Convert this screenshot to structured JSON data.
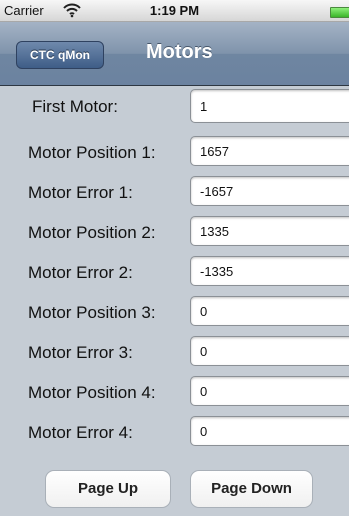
{
  "status_bar": {
    "carrier": "Carrier",
    "time": "1:19 PM",
    "wifi_icon": "wifi-icon",
    "battery_icon": "battery-icon",
    "battery_color": "#3bb52a"
  },
  "nav": {
    "back_label": "CTC qMon",
    "title": "Motors"
  },
  "form": {
    "first_motor": {
      "label": "First Motor:",
      "value": "1"
    },
    "rows": [
      {
        "label": "Motor Position 1:",
        "value": "1657"
      },
      {
        "label": "Motor Error 1:",
        "value": "-1657"
      },
      {
        "label": "Motor Position 2:",
        "value": "1335"
      },
      {
        "label": "Motor Error 2:",
        "value": "-1335"
      },
      {
        "label": "Motor Position 3:",
        "value": "0"
      },
      {
        "label": "Motor Error 3:",
        "value": "0"
      },
      {
        "label": "Motor Position 4:",
        "value": "0"
      },
      {
        "label": "Motor Error 4:",
        "value": "0"
      }
    ]
  },
  "buttons": {
    "page_up": "Page Up",
    "page_down": "Page Down"
  },
  "colors": {
    "background": "#c5ccd4",
    "nav_bar": "#7f93ab",
    "back_button": "#3e5d87"
  }
}
